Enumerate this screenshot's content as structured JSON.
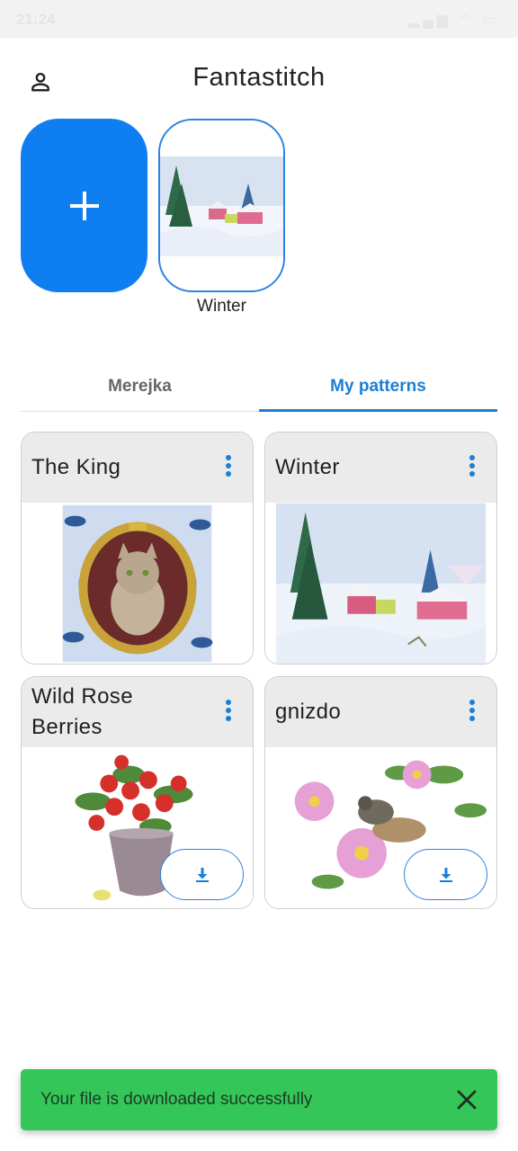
{
  "status_bar": {
    "time": "21:24",
    "icons": [
      "signal-icon",
      "wifi-icon",
      "battery-icon"
    ]
  },
  "app_bar": {
    "title": "Fantastitch",
    "profile_icon": "person-icon"
  },
  "recent": {
    "add_icon": "plus-icon",
    "items": [
      {
        "label": "Winter"
      }
    ]
  },
  "tabs": [
    {
      "label": "Merejka",
      "selected": false
    },
    {
      "label": "My patterns",
      "selected": true
    }
  ],
  "patterns": [
    {
      "title": "The King",
      "downloadable": false,
      "menu_icon": "more-vertical-icon"
    },
    {
      "title": "Winter",
      "downloadable": false,
      "menu_icon": "more-vertical-icon"
    },
    {
      "title": "Wild Rose Berries",
      "downloadable": true,
      "menu_icon": "more-vertical-icon",
      "download_icon": "download-icon"
    },
    {
      "title": "gnizdo",
      "downloadable": true,
      "menu_icon": "more-vertical-icon",
      "download_icon": "download-icon"
    }
  ],
  "snackbar": {
    "message": "Your file is downloaded successfully",
    "close_icon": "close-icon"
  },
  "colors": {
    "accent": "#0f7ef0",
    "tab_active": "#1a7fd4",
    "snackbar": "#34c659"
  }
}
